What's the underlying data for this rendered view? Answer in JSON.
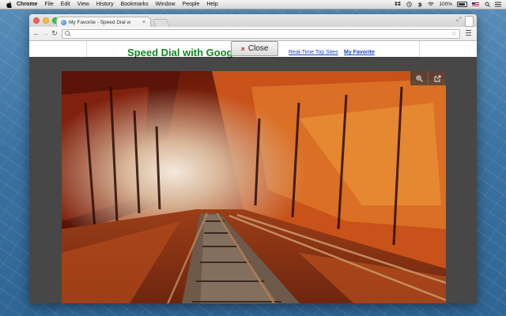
{
  "menubar": {
    "app_name": "Chrome",
    "items": [
      "File",
      "Edit",
      "View",
      "History",
      "Bookmarks",
      "Window",
      "People",
      "Help"
    ],
    "battery": "100%"
  },
  "browser": {
    "tab_title": "My Favorite - Speed Dial w",
    "tab_close": "×",
    "omnibox_value": "",
    "back": "←",
    "forward": "→",
    "reload": "↻"
  },
  "page": {
    "title": "Speed Dial with Google Drive",
    "links": [
      "Real-Time Top Sites",
      "My Favorite"
    ],
    "close_label": "Close",
    "close_icon": "×"
  },
  "icons": {
    "zoom": "magnifier-plus-icon",
    "open": "external-link-icon"
  },
  "colors": {
    "title_green": "#0e8a1e",
    "link_blue": "#1a44c4",
    "close_x_red": "#c4281c"
  }
}
